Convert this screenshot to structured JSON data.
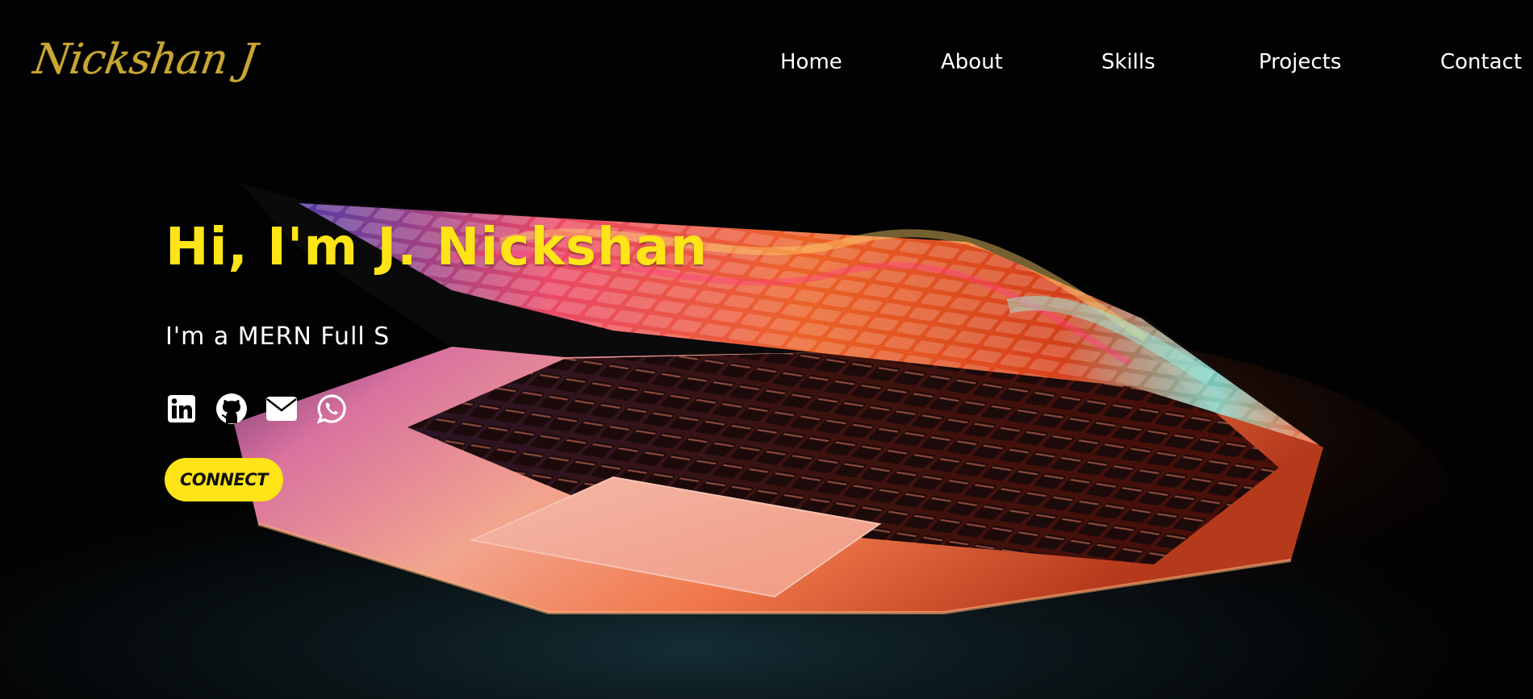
{
  "header": {
    "logo_text": "Nickshan J",
    "nav": [
      {
        "label": "Home"
      },
      {
        "label": "About"
      },
      {
        "label": "Skills"
      },
      {
        "label": "Projects"
      },
      {
        "label": "Contact"
      }
    ]
  },
  "hero": {
    "title": "Hi, I'm J. Nickshan",
    "subtitle": "I'm a MERN Full S",
    "socials": [
      {
        "icon": "linkedin-icon"
      },
      {
        "icon": "github-icon"
      },
      {
        "icon": "email-icon"
      },
      {
        "icon": "whatsapp-icon"
      }
    ],
    "cta_label": "CONNECT"
  },
  "colors": {
    "accent": "#ffe417",
    "logo": "#c8a734",
    "background": "#020202",
    "nav_text": "#ffffff"
  }
}
